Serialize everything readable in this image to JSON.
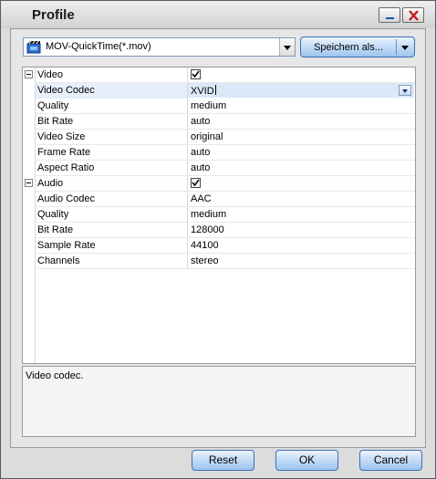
{
  "window": {
    "title": "Profile"
  },
  "format": {
    "value": "MOV-QuickTime(*.mov)"
  },
  "save_button": {
    "label": "Speichern als..."
  },
  "properties": {
    "video": {
      "label": "Video",
      "checked": true,
      "rows": [
        {
          "name": "Video Codec",
          "value": "XVID"
        },
        {
          "name": "Quality",
          "value": "medium"
        },
        {
          "name": "Bit Rate",
          "value": "auto"
        },
        {
          "name": "Video Size",
          "value": "original"
        },
        {
          "name": "Frame Rate",
          "value": "auto"
        },
        {
          "name": "Aspect Ratio",
          "value": "auto"
        }
      ]
    },
    "audio": {
      "label": "Audio",
      "checked": true,
      "rows": [
        {
          "name": "Audio Codec",
          "value": "AAC"
        },
        {
          "name": "Quality",
          "value": "medium"
        },
        {
          "name": "Bit Rate",
          "value": "128000"
        },
        {
          "name": "Sample Rate",
          "value": "44100"
        },
        {
          "name": "Channels",
          "value": "stereo"
        }
      ]
    }
  },
  "description": "Video codec.",
  "buttons": {
    "reset": "Reset",
    "ok": "OK",
    "cancel": "Cancel"
  },
  "colors": {
    "selection": "#dbe8f8",
    "button_border": "#3d6fb3",
    "close_icon": "#c0201a"
  }
}
